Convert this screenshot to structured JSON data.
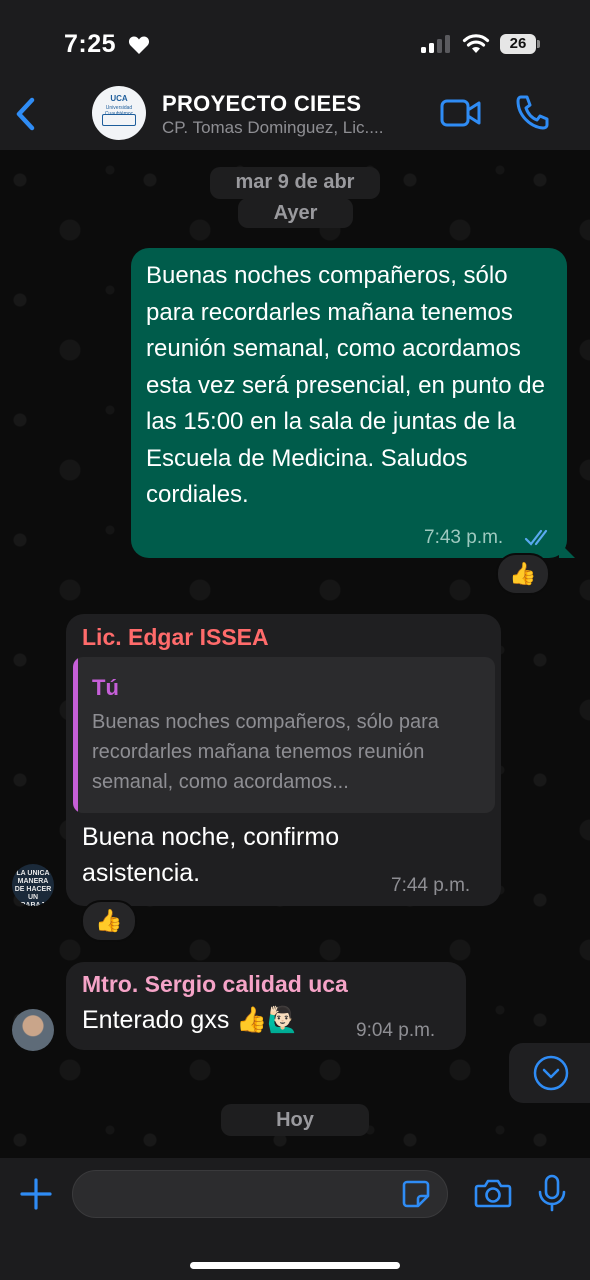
{
  "status_bar": {
    "time": "7:25",
    "battery": "26"
  },
  "header": {
    "back_label": "",
    "title": "PROYECTO CIEES",
    "subtitle": "CP. Tomas Dominguez, Lic....",
    "avatar_text_1": "UCA",
    "avatar_text_2": "Universidad Cuauhtémoc"
  },
  "chat": {
    "date_label": "mar 9 de abr",
    "day_label": "Ayer",
    "today_label": "Hoy",
    "messages": [
      {
        "direction": "outgoing",
        "text": "Buenas noches compañeros, sólo para recordarles mañana tenemos reunión semanal, como acordamos esta vez será presencial, en punto de las 15:00 en la sala de juntas de la Escuela de Medicina. Saludos cordiales.",
        "time": "7:43 p.m.",
        "status": "read",
        "reaction": "👍"
      },
      {
        "direction": "incoming",
        "sender": "Lic. Edgar ISSEA",
        "sender_color": "#ff6b6b",
        "quote_author": "Tú",
        "quote_text": "Buenas noches compañeros, sólo para recordarles mañana tenemos reunión semanal, como acordamos...",
        "text": "Buena noche, confirmo asistencia.",
        "time": "7:44 p.m.",
        "reaction": "👍",
        "avatar_text": "LA UNICA MANERA DE HACER UN TRABAJO GENIAL ES AMAR LO QUE HACES"
      },
      {
        "direction": "incoming",
        "sender": "Mtro. Sergio calidad uca",
        "sender_color": "#f5a3c7",
        "text": "Enterado gxs 👍🙋🏻‍♂️",
        "time": "9:04 p.m."
      }
    ]
  },
  "input": {
    "placeholder": "",
    "value": ""
  },
  "colors": {
    "outgoing_bubble": "#005c4b",
    "incoming_bubble": "#1f1f21",
    "accent_blue": "#2f8cf5"
  }
}
